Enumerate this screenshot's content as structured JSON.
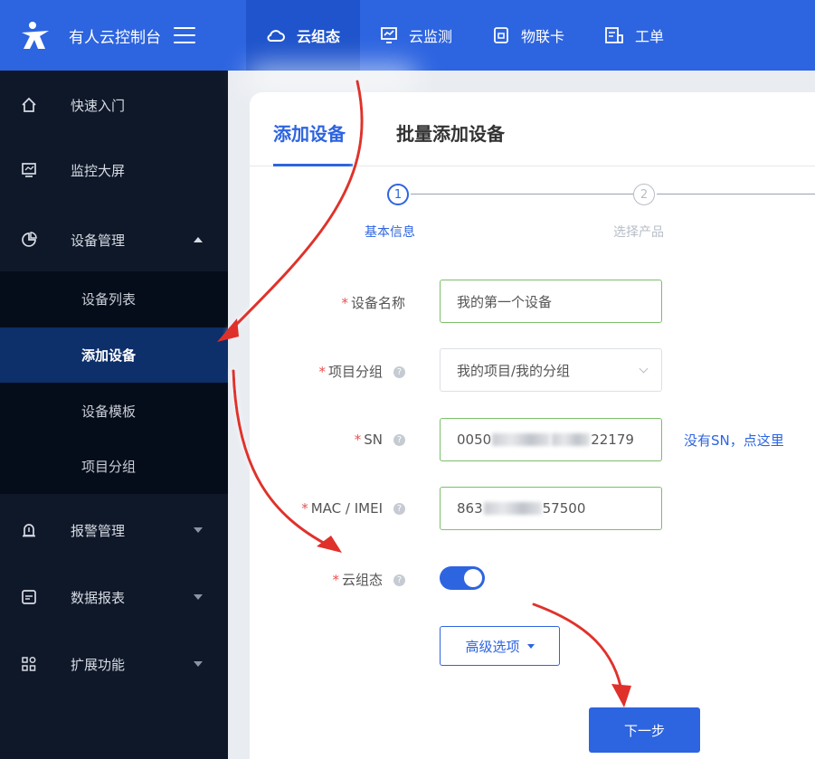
{
  "header": {
    "brand_title": "有人云控制台",
    "nav": [
      {
        "label": "云组态",
        "icon": "cloud-icon",
        "active": true
      },
      {
        "label": "云监测",
        "icon": "monitor-icon",
        "active": false
      },
      {
        "label": "物联卡",
        "icon": "sim-card-icon",
        "active": false
      },
      {
        "label": "工单",
        "icon": "ticket-icon",
        "active": false
      }
    ]
  },
  "sidebar": {
    "items": [
      {
        "label": "快速入门",
        "icon": "home-icon"
      },
      {
        "label": "监控大屏",
        "icon": "screen-icon"
      },
      {
        "label": "设备管理",
        "icon": "pie-chart-icon",
        "expanded": true
      },
      {
        "label": "报警管理",
        "icon": "alarm-bell-icon"
      },
      {
        "label": "数据报表",
        "icon": "report-icon"
      },
      {
        "label": "扩展功能",
        "icon": "apps-grid-icon"
      }
    ],
    "sub_items": [
      {
        "label": "设备列表",
        "active": false
      },
      {
        "label": "添加设备",
        "active": true
      },
      {
        "label": "设备模板",
        "active": false
      },
      {
        "label": "项目分组",
        "active": false
      }
    ]
  },
  "main": {
    "tabs": [
      {
        "label": "添加设备",
        "active": true
      },
      {
        "label": "批量添加设备",
        "active": false
      }
    ],
    "steps": [
      {
        "number": "1",
        "label": "基本信息",
        "active": true
      },
      {
        "number": "2",
        "label": "选择产品",
        "active": false
      }
    ],
    "form": {
      "device_name": {
        "label": "设备名称",
        "value": "我的第一个设备"
      },
      "project_group": {
        "label": "项目分组",
        "value": "我的项目/我的分组"
      },
      "sn": {
        "label": "SN",
        "value_prefix": "0050",
        "value_suffix": "22179",
        "link": "没有SN，点这里"
      },
      "mac_imei": {
        "label": "MAC / IMEI",
        "value_prefix": "863",
        "value_suffix": "57500"
      },
      "cloud_config": {
        "label": "云组态",
        "enabled": true
      }
    },
    "advanced_label": "高级选项",
    "next_label": "下一步"
  },
  "colors": {
    "primary": "#2d64e0",
    "sidebar_bg": "#0e1829",
    "active_sub_bg": "#0d2f6a",
    "annotation_arrow": "#e0302a",
    "required": "#e85151"
  }
}
